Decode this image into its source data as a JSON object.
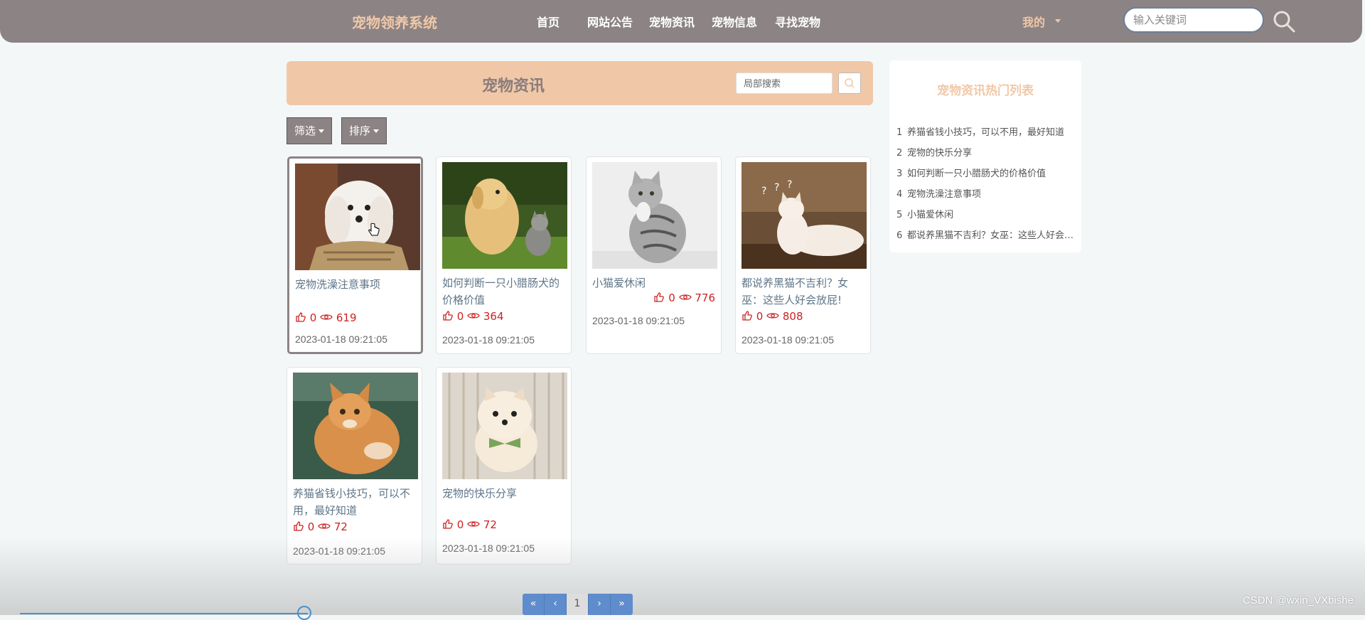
{
  "header": {
    "brand": "宠物领养系统",
    "nav": [
      "首页",
      "网站公告",
      "宠物资讯",
      "宠物信息",
      "寻找宠物"
    ],
    "user_menu": "我的",
    "search_placeholder": "输入关键词"
  },
  "page": {
    "title": "宠物资讯",
    "local_search_placeholder": "局部搜索",
    "filter_label": "筛选",
    "sort_label": "排序"
  },
  "cards": [
    {
      "title": "宠物洗澡注意事项",
      "likes": "0",
      "views": "619",
      "date": "2023-01-18 09:21:05",
      "image": "white-puppy"
    },
    {
      "title": "如何判断一只小腊肠犬的价格价值",
      "likes": "0",
      "views": "364",
      "date": "2023-01-18 09:21:05",
      "image": "puppy-and-kitten"
    },
    {
      "title": "小猫爱休闲",
      "likes": "0",
      "views": "776",
      "date": "2023-01-18 09:21:05",
      "image": "tabby-cat"
    },
    {
      "title": "都说养黑猫不吉利？女巫：这些人好会放屁!",
      "likes": "0",
      "views": "808",
      "date": "2023-01-18 09:21:05",
      "image": "white-cat-question"
    },
    {
      "title": "养猫省钱小技巧，可以不用，最好知道",
      "likes": "0",
      "views": "72",
      "date": "2023-01-18 09:21:05",
      "image": "orange-kitten"
    },
    {
      "title": "宠物的快乐分享",
      "likes": "0",
      "views": "72",
      "date": "2023-01-18 09:21:05",
      "image": "pomeranian"
    }
  ],
  "hot_list": {
    "title": "宠物资讯热门列表",
    "items": [
      {
        "n": "1",
        "text": "养猫省钱小技巧，可以不用，最好知道"
      },
      {
        "n": "2",
        "text": "宠物的快乐分享"
      },
      {
        "n": "3",
        "text": "如何判断一只小腊肠犬的价格价值"
      },
      {
        "n": "4",
        "text": "宠物洗澡注意事项"
      },
      {
        "n": "5",
        "text": "小猫爱休闲"
      },
      {
        "n": "6",
        "text": "都说养黑猫不吉利？女巫：这些人好会放屁!"
      }
    ]
  },
  "pagination": {
    "first": "«",
    "prev": "‹",
    "current": "1",
    "next": "›",
    "last": "»"
  },
  "watermark": "CSDN @wxin_VXbishe",
  "colors": {
    "nav_bg": "#8c8384",
    "accent": "#f0c8a8",
    "stat_red": "#cc2222",
    "pager_blue": "#5f8ccc"
  }
}
